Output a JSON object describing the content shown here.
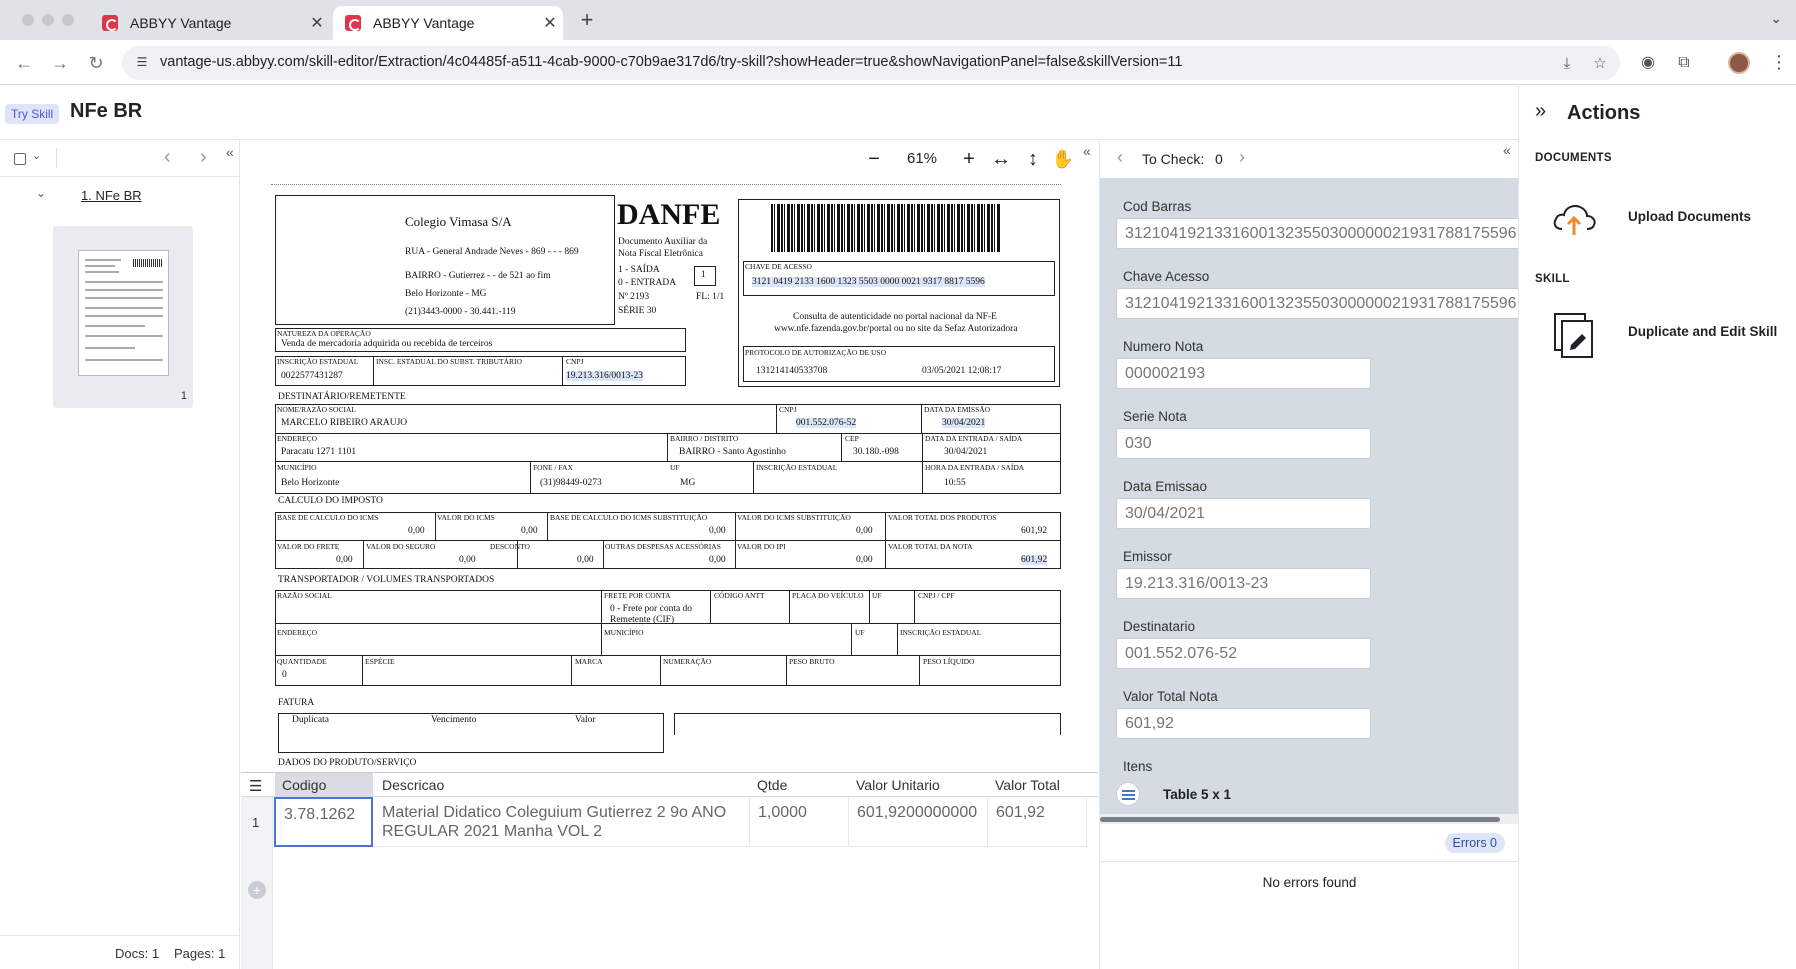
{
  "browser": {
    "tabs": [
      {
        "label": "ABBYY Vantage",
        "active": false
      },
      {
        "label": "ABBYY Vantage",
        "active": true
      }
    ],
    "url": "vantage-us.abbyy.com/skill-editor/Extraction/4c04485f-a511-4cab-9000-c70b9ae317d6/try-skill?showHeader=true&showNavigationPanel=false&skillVersion=11"
  },
  "app": {
    "badge": "Try Skill",
    "title": "NFe BR"
  },
  "left_panel": {
    "document_name": "1. NFe BR",
    "page_number": "1",
    "footer_docs": "Docs: 1",
    "footer_pages": "Pages: 1"
  },
  "viewer": {
    "zoom": "61%"
  },
  "danfe": {
    "company": "Colegio Vimasa S/A",
    "addr1": "RUA - General Andrade Neves - 869 - -   - 869",
    "addr2": "BAIRRO - Gutierrez        -  - de 521 ao fim",
    "addr3": "Belo Horizonte         -  MG",
    "addr4": "(21)3443-0000        -  30.441.-119",
    "title": "DANFE",
    "subtitle1": "Documento Auxiliar da",
    "subtitle2": "Nota Fiscal Eletrônica",
    "saida": "1 - SAÍDA",
    "entrada": "0 - ENTRADA",
    "tipo": "1",
    "numero": "Nº   2193",
    "fl": "FL:  1/1",
    "serie": "SÉRIE    30",
    "chave_lbl": "CHAVE DE ACESSO",
    "chave": "3121 0419 2133 1600 1323 5503 0000 0021 9317 8817 5596",
    "consulta1": "Consulta de autenticidade no portal nacional da NF-E",
    "consulta2": "www.nfe.fazenda.gov.br/portal ou no site da Sefaz Autorizadora",
    "natureza_lbl": "NATUREZA DA OPERAÇÃO",
    "natureza": "Venda de mercadoria adquirida ou recebida de terceiros",
    "protocolo_lbl": "PROTOCOLO DE AUTORIZAÇÃO DE USO",
    "protocolo": "131214140533708",
    "protocolo_data": "03/05/2021 12:08:17",
    "ie_lbl": "INSCRIÇÃO ESTADUAL",
    "ie": "0022577431287",
    "iest_lbl": "INSC. ESTADUAL DO SUBST. TRIBUTÁRIO",
    "cnpj_lbl": "CNPJ",
    "cnpj": "19.213.316/0013-23",
    "dest_section": "DESTINATÁRIO/REMETENTE",
    "nome_lbl": "NOME/RAZÃO SOCIAL",
    "nome": "MARCELO RIBEIRO ARAUJO",
    "dest_cnpj_lbl": "CNPJ",
    "dest_cnpj": "001.552.076-52",
    "emissao_lbl": "DATA DA EMISSÃO",
    "emissao": "30/04/2021",
    "endereco_lbl": "ENDEREÇO",
    "endereco": "Paracatu                                    1271        1101",
    "bairro_lbl": "BAIRRO / DISTRITO",
    "bairro": "BAIRRO - Santo Agostinho",
    "cep_lbl": "CEP",
    "cep": "30.180.-098",
    "entrada_lbl": "DATA DA ENTRADA / SAÍDA",
    "entrada_data": "30/04/2021",
    "municipio_lbl": "MUNICÍPIO",
    "municipio": "Belo Horizonte",
    "fone_lbl": "FONE / FAX",
    "fone": "(31)98449-0273",
    "uf_lbl": "UF",
    "uf": "MG",
    "ie_dest_lbl": "INSCRIÇÃO ESTADUAL",
    "hora_lbl": "HORA DA ENTRADA / SAÍDA",
    "hora": "10:55",
    "calc_section": "CALCULO DO IMPOSTO",
    "bc_icms_lbl": "BASE DE CALCULO DO ICMS",
    "bc_icms": "0,00",
    "v_icms_lbl": "VALOR DO ICMS",
    "v_icms": "0,00",
    "bc_st_lbl": "BASE DE CALCULO DO ICMS SUBSTITUIÇÃO",
    "bc_st": "0,00",
    "v_st_lbl": "VALOR DO ICMS SUBSTITUIÇÃO",
    "v_st": "0,00",
    "v_prod_lbl": "VALOR TOTAL DOS PRODUTOS",
    "v_prod": "601,92",
    "frete_lbl": "VALOR DO FRETE",
    "frete": "0,00",
    "seguro_lbl": "VALOR DO SEGURO",
    "seguro": "0,00",
    "desconto_lbl": "DESCONTO",
    "desconto": "0,00",
    "outras_lbl": "OUTRAS DESPESAS ACESSÓRIAS",
    "outras": "0,00",
    "ipi_lbl": "VALOR DO IPI",
    "ipi": "0,00",
    "v_nota_lbl": "VALOR TOTAL DA NOTA",
    "v_nota": "601,92",
    "transp_section": "TRANSPORTADOR / VOLUMES TRANSPORTADOS",
    "razao_lbl": "RAZÃO SOCIAL",
    "frete_conta_lbl": "FRETE POR CONTA",
    "frete_conta": "0 - Frete por conta do",
    "frete_conta2": "Remetente (CIF)",
    "antt_lbl": "CÓDIGO ANTT",
    "placa_lbl": "PLACA DO VEÍCULO",
    "t_uf_lbl": "UF",
    "t_cnpj_lbl": "CNPJ / CPF",
    "t_end_lbl": "ENDEREÇO",
    "t_mun_lbl": "MUNICÍPIO",
    "t_uf2_lbl": "UF",
    "t_ie_lbl": "INSCRIÇÃO ESTADUAL",
    "qtd_lbl": "QUANTIDADE",
    "qtd": "0",
    "especie_lbl": "ESPÉCIE",
    "marca_lbl": "MARCA",
    "numeracao_lbl": "NUMERAÇÃO",
    "pbruto_lbl": "PESO BRUTO",
    "pliq_lbl": "PESO LÍQUIDO",
    "fatura_section": "FATURA",
    "duplicata": "Duplicata",
    "vencimento": "Vencimento",
    "valor": "Valor",
    "produto_section": "DADOS DO PRODUTO/SERVIÇO"
  },
  "items_table": {
    "columns": [
      "Codigo",
      "Descricao",
      "Qtde",
      "Valor Unitario",
      "Valor Total"
    ],
    "rows": [
      {
        "num": "1",
        "codigo": "3.78.1262",
        "descricao": "Material Didatico Coleguium Gutierrez 2 9o ANO REGULAR 2021 Manha VOL 2",
        "qtde": "1,0000",
        "valor_unitario": "601,9200000000",
        "valor_total": "601,92"
      }
    ]
  },
  "fields_panel": {
    "to_check_label": "To Check:",
    "to_check_count": "0",
    "fields": [
      {
        "label": "Cod Barras",
        "value": "31210419213316001323550300000021931788175596"
      },
      {
        "label": "Chave Acesso",
        "value": "31210419213316001323550300000021931788175596"
      },
      {
        "label": "Numero Nota",
        "value": "000002193"
      },
      {
        "label": "Serie Nota",
        "value": "030"
      },
      {
        "label": "Data Emissao",
        "value": "30/04/2021"
      },
      {
        "label": "Emissor",
        "value": "19.213.316/0013-23"
      },
      {
        "label": "Destinatario",
        "value": "001.552.076-52"
      },
      {
        "label": "Valor Total Nota",
        "value": "601,92"
      }
    ],
    "itens_label": "Itens",
    "table_link": "Table 5 x 1",
    "errors_badge": "Errors 0",
    "no_errors": "No errors found"
  },
  "actions_panel": {
    "title": "Actions",
    "documents_section": "DOCUMENTS",
    "upload_label": "Upload Documents",
    "skill_section": "SKILL",
    "duplicate_label": "Duplicate and Edit Skill"
  },
  "colors": {
    "accent_blue": "#4a73d6",
    "brand_red": "#e0354a",
    "upload_arrow_orange": "#f08a24",
    "fields_bg": "#d5dbe2"
  }
}
